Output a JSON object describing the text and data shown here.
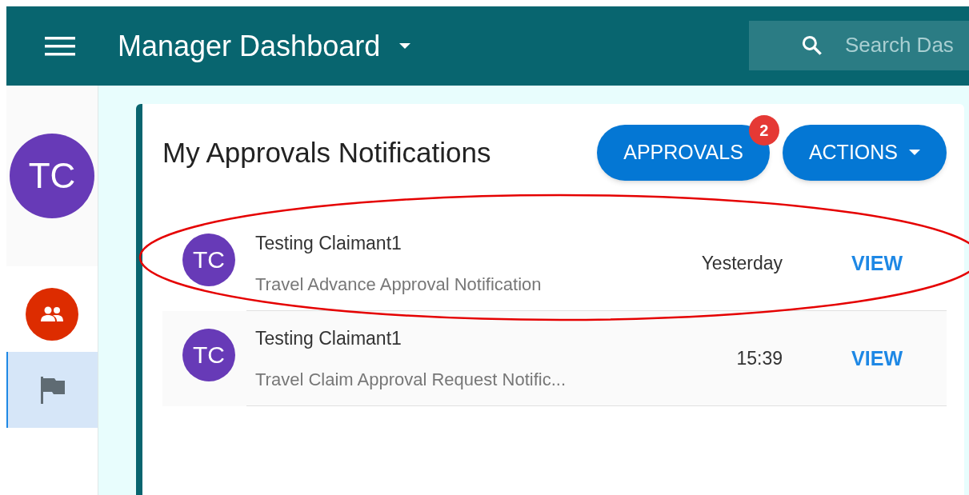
{
  "app_bar": {
    "title": "Manager Dashboard",
    "search": {
      "placeholder": "Search Das"
    }
  },
  "sidebar": {
    "avatar": "TC",
    "items": [
      {
        "kind": "people",
        "selected": false
      },
      {
        "kind": "flag",
        "selected": true
      }
    ]
  },
  "card": {
    "title": "My Approvals Notifications",
    "buttons": [
      {
        "kind": "button",
        "label": "APPROVALS",
        "badge": "2"
      },
      {
        "kind": "menu",
        "label": "ACTIONS"
      }
    ],
    "notifications": [
      {
        "avatar": "TC",
        "name": "Testing Claimant1",
        "subject": "Travel Advance Approval Notification",
        "time": "Yesterday",
        "action": "VIEW",
        "highlighted": true
      },
      {
        "avatar": "TC",
        "name": "Testing Claimant1",
        "subject": "Travel Claim Approval Request Notific...",
        "time": "15:39",
        "action": "VIEW",
        "highlighted": false
      }
    ]
  }
}
